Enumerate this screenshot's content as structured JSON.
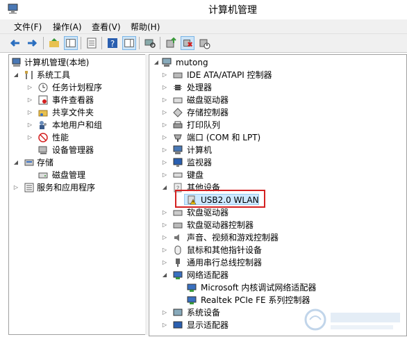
{
  "window": {
    "title": "计算机管理"
  },
  "menu": [
    "文件(F)",
    "操作(A)",
    "查看(V)",
    "帮助(H)"
  ],
  "toolbar_icons": [
    "back-icon",
    "forward-icon",
    "up-folder-icon",
    "show-tree-icon",
    "properties-icon",
    "help-icon",
    "action-pane-icon",
    "scan-hardware-icon",
    "update-driver-icon",
    "uninstall-icon",
    "disable-device-icon"
  ],
  "left_tree": [
    {
      "label": "计算机管理(本地)",
      "icon": "computer-management-icon"
    },
    {
      "label": "系统工具",
      "icon": "tools-icon"
    },
    {
      "label": "任务计划程序",
      "icon": "clock-icon"
    },
    {
      "label": "事件查看器",
      "icon": "event-viewer-icon"
    },
    {
      "label": "共享文件夹",
      "icon": "shared-folder-icon"
    },
    {
      "label": "本地用户和组",
      "icon": "users-icon"
    },
    {
      "label": "性能",
      "icon": "performance-icon"
    },
    {
      "label": "设备管理器",
      "icon": "device-manager-icon"
    },
    {
      "label": "存储",
      "icon": "storage-icon"
    },
    {
      "label": "磁盘管理",
      "icon": "disk-management-icon"
    },
    {
      "label": "服务和应用程序",
      "icon": "services-icon"
    }
  ],
  "right_tree": [
    {
      "label": "mutong",
      "icon": "computer-icon"
    },
    {
      "label": "IDE ATA/ATAPI 控制器",
      "icon": "ide-controller-icon"
    },
    {
      "label": "处理器",
      "icon": "processor-icon"
    },
    {
      "label": "磁盘驱动器",
      "icon": "disk-drive-icon"
    },
    {
      "label": "存储控制器",
      "icon": "storage-controller-icon"
    },
    {
      "label": "打印队列",
      "icon": "printer-icon"
    },
    {
      "label": "端口 (COM 和 LPT)",
      "icon": "port-icon"
    },
    {
      "label": "计算机",
      "icon": "computer-icon"
    },
    {
      "label": "监视器",
      "icon": "monitor-icon"
    },
    {
      "label": "键盘",
      "icon": "keyboard-icon"
    },
    {
      "label": "其他设备",
      "icon": "other-devices-icon"
    },
    {
      "label": "USB2.0 WLAN",
      "icon": "warning-device-icon"
    },
    {
      "label": "软盘驱动器",
      "icon": "floppy-drive-icon"
    },
    {
      "label": "软盘驱动器控制器",
      "icon": "floppy-controller-icon"
    },
    {
      "label": "声音、视频和游戏控制器",
      "icon": "sound-icon"
    },
    {
      "label": "鼠标和其他指针设备",
      "icon": "mouse-icon"
    },
    {
      "label": "通用串行总线控制器",
      "icon": "usb-icon"
    },
    {
      "label": "网络适配器",
      "icon": "network-adapter-icon"
    },
    {
      "label": "Microsoft 内核调试网络适配器",
      "icon": "network-card-icon"
    },
    {
      "label": "Realtek PCIe FE 系列控制器",
      "icon": "network-card-icon"
    },
    {
      "label": "系统设备",
      "icon": "system-device-icon"
    },
    {
      "label": "显示适配器",
      "icon": "display-adapter-icon"
    }
  ],
  "colors": {
    "highlight_border": "#d42020",
    "selection": "#cde8ff",
    "pane_border": "#a0a0a0"
  }
}
